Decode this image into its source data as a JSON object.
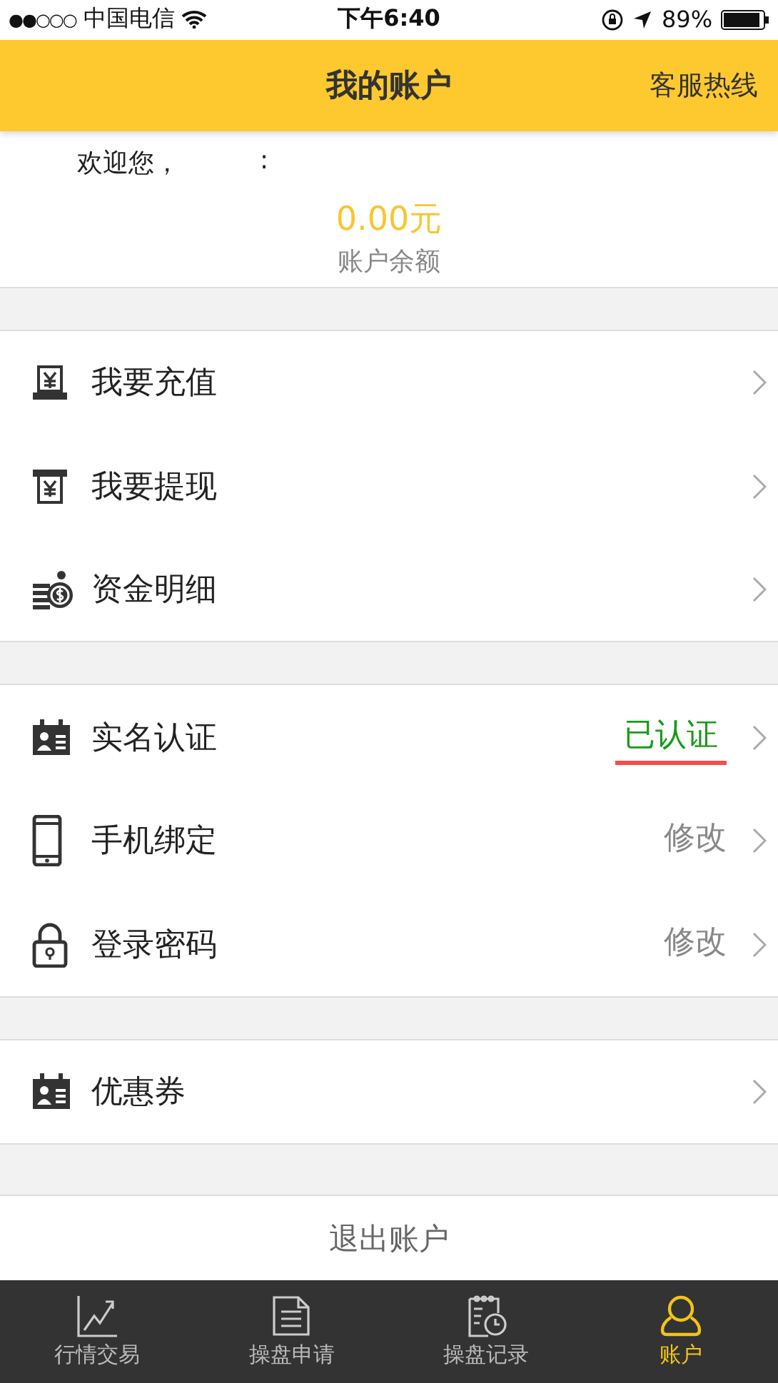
{
  "status_bar": {
    "signal": "●●○○○",
    "carrier": "中国电信",
    "time": "下午6:40",
    "battery": "89%"
  },
  "header": {
    "title": "我的账户",
    "action": "客服热线"
  },
  "account": {
    "welcome": "欢迎您，",
    "welcome_end": ":",
    "balance": "0.00元",
    "balance_label": "账户余额"
  },
  "groups": [
    {
      "rows": [
        {
          "label": "我要充值"
        },
        {
          "label": "我要提现"
        },
        {
          "label": "资金明细"
        }
      ]
    },
    {
      "rows": [
        {
          "label": "实名认证",
          "value": "已认证",
          "kind": "status"
        },
        {
          "label": "手机绑定",
          "value": "修改",
          "kind": "action"
        },
        {
          "label": "登录密码",
          "value": "修改",
          "kind": "action"
        }
      ]
    },
    {
      "rows": [
        {
          "label": "优惠券"
        }
      ]
    }
  ],
  "logout": "退出账户",
  "tabs": [
    {
      "label": "行情交易",
      "selected": false
    },
    {
      "label": "操盘申请",
      "selected": false
    },
    {
      "label": "操盘记录",
      "selected": false
    },
    {
      "label": "账户",
      "selected": true
    }
  ]
}
